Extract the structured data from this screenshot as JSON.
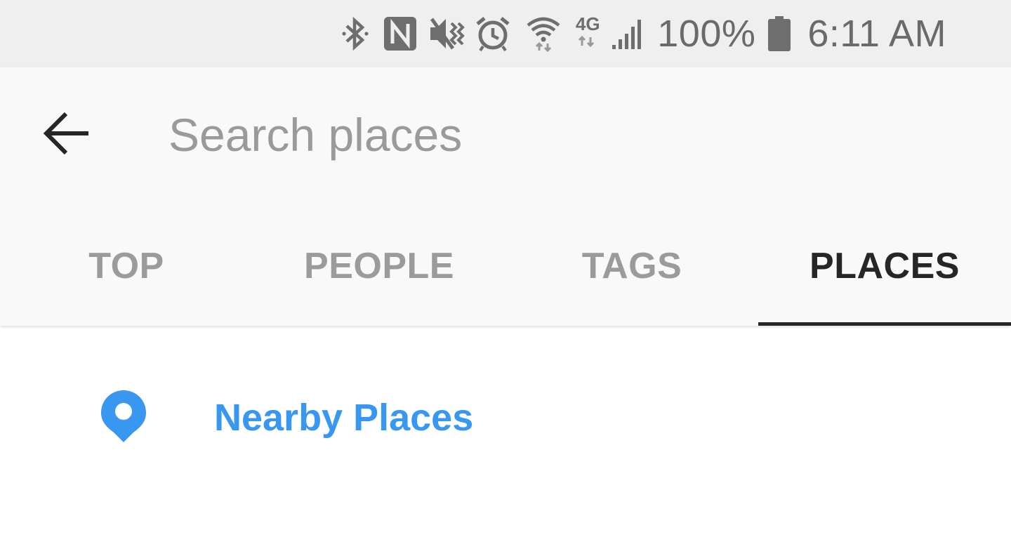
{
  "status_bar": {
    "icons": [
      "bluetooth-icon",
      "nfc-icon",
      "vibrate-icon",
      "alarm-icon",
      "wifi-icon",
      "4g-lte-icon",
      "signal-icon",
      "battery-icon"
    ],
    "network_label": "4G",
    "battery_text": "100%",
    "time": "6:11 AM"
  },
  "search": {
    "placeholder": "Search places",
    "value": ""
  },
  "tabs": [
    {
      "label": "TOP",
      "active": false
    },
    {
      "label": "PEOPLE",
      "active": false
    },
    {
      "label": "TAGS",
      "active": false
    },
    {
      "label": "PLACES",
      "active": true
    }
  ],
  "results": {
    "nearby_label": "Nearby Places"
  },
  "colors": {
    "accent": "#3897f0",
    "active_tab": "#262626",
    "inactive_tab": "#9b9b9b",
    "status_bar_bg": "#efefef",
    "app_bar_bg": "#f9f9f9"
  }
}
